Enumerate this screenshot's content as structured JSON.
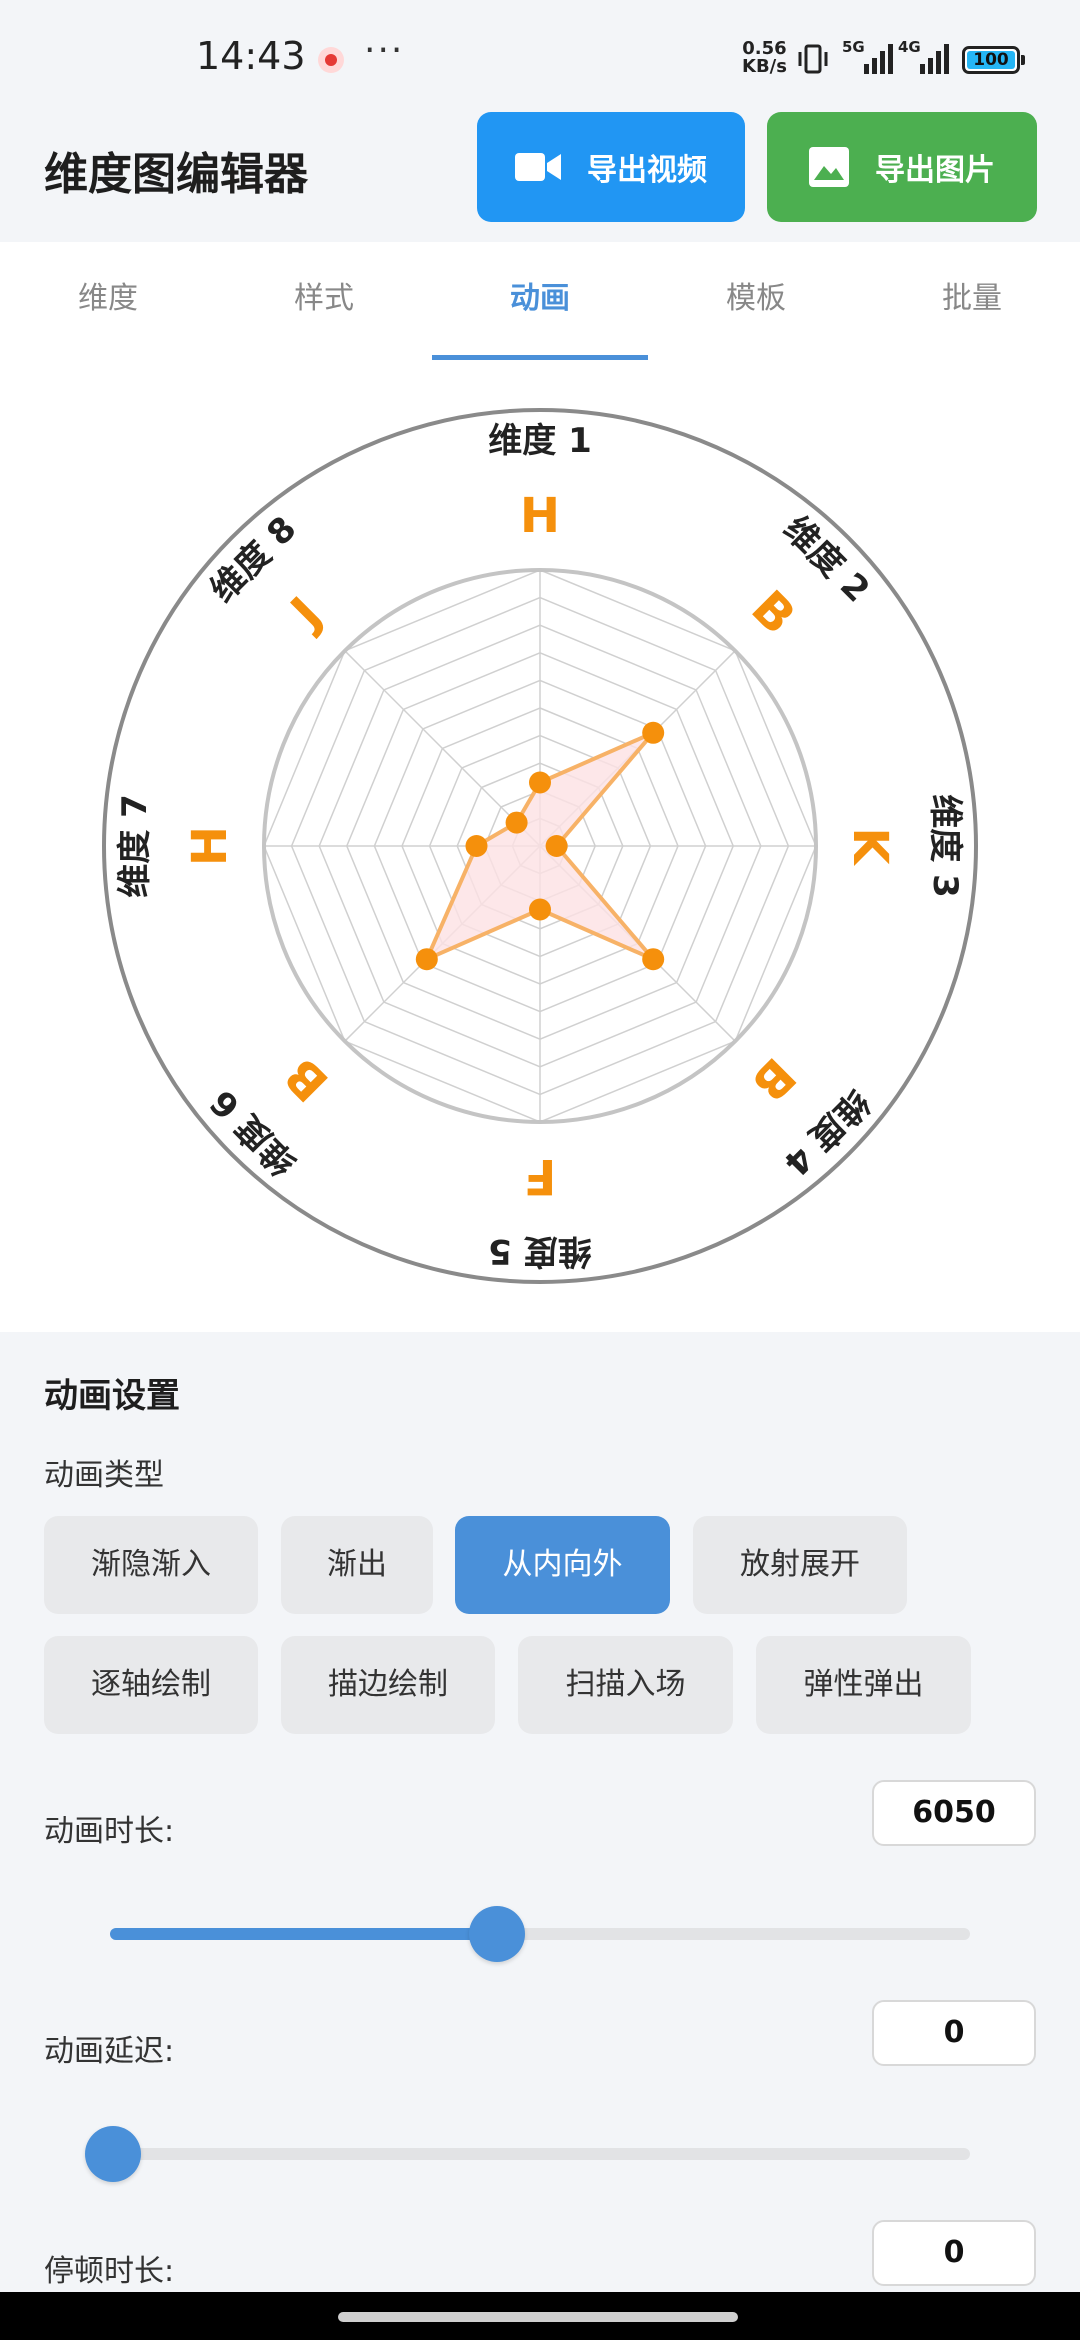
{
  "status_bar": {
    "time": "14:43",
    "net_speed_value": "0.56",
    "net_speed_unit": "KB/s",
    "signal1_label": "5G",
    "signal2_label": "4G",
    "battery": "100"
  },
  "app_bar": {
    "title": "维度图编辑器",
    "export_video_label": "导出视频",
    "export_image_label": "导出图片",
    "video_icon": "video-camera-icon",
    "image_icon": "image-icon"
  },
  "tabs": [
    {
      "label": "维度",
      "active": false
    },
    {
      "label": "样式",
      "active": false
    },
    {
      "label": "动画",
      "active": true
    },
    {
      "label": "模板",
      "active": false
    },
    {
      "label": "批量",
      "active": false
    }
  ],
  "chart_data": {
    "type": "radar",
    "axes": [
      "维度 1",
      "维度 2",
      "维度 3",
      "维度 4",
      "维度 5",
      "维度 6",
      "维度 7",
      "维度 8"
    ],
    "grades": [
      "H",
      "B",
      "K",
      "B",
      "F",
      "B",
      "H",
      "J"
    ],
    "values": [
      0.23,
      0.58,
      0.06,
      0.58,
      0.23,
      0.58,
      0.23,
      0.12
    ],
    "range": [
      0,
      1
    ],
    "rings": 10,
    "colors": {
      "series_line": "#f7b267",
      "series_fill": "#fde1e4",
      "point": "#f5900c",
      "grade": "#f5900c",
      "grid": "#d0d0d0",
      "outer_ring": "#8a8a8a"
    }
  },
  "settings": {
    "title": "动画设置",
    "animation_type_label": "动画类型",
    "animation_types": [
      {
        "label": "渐隐渐入",
        "active": false
      },
      {
        "label": "渐出",
        "active": false
      },
      {
        "label": "从内向外",
        "active": true
      },
      {
        "label": "放射展开",
        "active": false
      },
      {
        "label": "逐轴绘制",
        "active": false
      },
      {
        "label": "描边绘制",
        "active": false
      },
      {
        "label": "扫描入场",
        "active": false
      },
      {
        "label": "弹性弹出",
        "active": false
      }
    ],
    "duration_label": "动画时长:",
    "duration_value": "6050",
    "duration_fraction": 0.45,
    "delay_label": "动画延迟:",
    "delay_value": "0",
    "delay_fraction": 0.0,
    "pause_label": "停顿时长:",
    "pause_value": "0"
  }
}
